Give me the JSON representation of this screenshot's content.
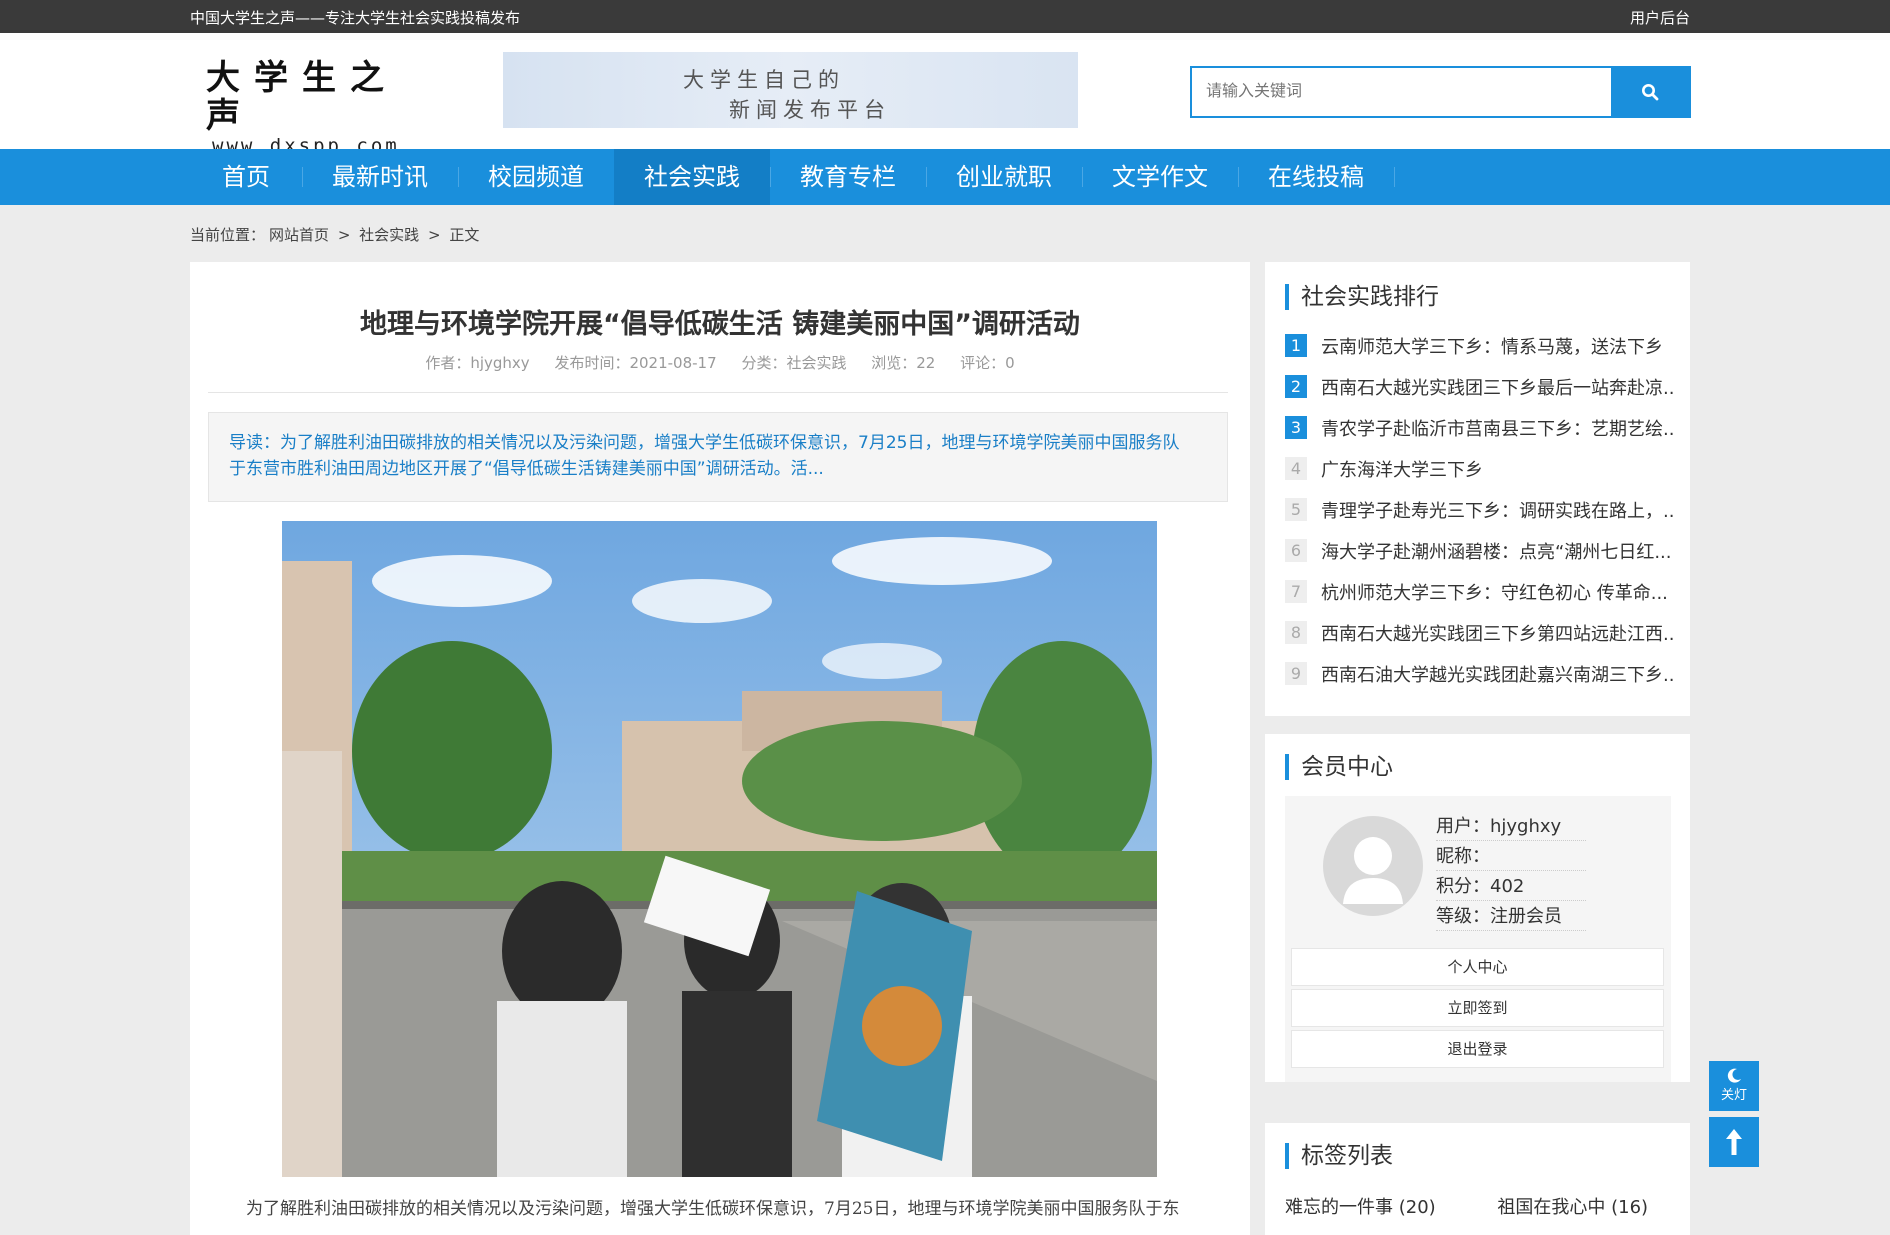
{
  "topbar": {
    "slogan": "中国大学生之声——专注大学生社会实践投稿发布",
    "admin": "用户后台"
  },
  "logo": {
    "name": "大学生之声",
    "domain": "www.dxspp.com"
  },
  "banner": {
    "line1": "大学生自己的",
    "line2": "新闻发布平台"
  },
  "search": {
    "placeholder": "请输入关键词"
  },
  "nav": [
    "首页",
    "最新时讯",
    "校园频道",
    "社会实践",
    "教育专栏",
    "创业就职",
    "文学作文",
    "在线投稿"
  ],
  "breadcrumb": {
    "prefix": "当前位置：",
    "home": "网站首页",
    "sep": ">",
    "category": "社会实践",
    "current": "正文"
  },
  "article": {
    "title": "地理与环境学院开展“倡导低碳生活 铸建美丽中国”调研活动",
    "author": "作者：hjyghxy",
    "date": "发布时间：2021-08-17",
    "category": "分类：社会实践",
    "views": "浏览：22",
    "comments": "评论：0",
    "lead_line1": "导读：为了解胜利油田碳排放的相关情况以及污染问题，增强大学生低碳环保意识，7月25日，地理与环境学院美丽中国服务队",
    "lead_line2": "于东营市胜利油田周边地区开展了“倡导低碳生活铸建美丽中国”调研活动。活...",
    "body": "为了解胜利油田碳排放的相关情况以及污染问题，增强大学生低碳环保意识，7月25日，地理与环境学院美丽中国服务队于东"
  },
  "ranking": {
    "title": "社会实践排行",
    "items": [
      {
        "n": "1",
        "t": "云南师范大学三下乡：情系马蔑，送法下乡"
      },
      {
        "n": "2",
        "t": "西南石大越光实践团三下乡最后一站奔赴凉..."
      },
      {
        "n": "3",
        "t": "青农学子赴临沂市莒南县三下乡：艺期艺绘..."
      },
      {
        "n": "4",
        "t": "广东海洋大学三下乡"
      },
      {
        "n": "5",
        "t": "青理学子赴寿光三下乡：调研实践在路上，..."
      },
      {
        "n": "6",
        "t": "海大学子赴潮州涵碧楼：点亮“潮州七日红..."
      },
      {
        "n": "7",
        "t": "杭州师范大学三下乡：守红色初心 传革命..."
      },
      {
        "n": "8",
        "t": "西南石大越光实践团三下乡第四站远赴江西..."
      },
      {
        "n": "9",
        "t": "西南石油大学越光实践团赴嘉兴南湖三下乡..."
      }
    ]
  },
  "member": {
    "title": "会员中心",
    "user": "用户：hjyghxy",
    "nickname": "昵称：",
    "points": "积分：402",
    "level": "等级：注册会员",
    "btn_center": "个人中心",
    "btn_sign": "立即签到",
    "btn_logout": "退出登录"
  },
  "tags": {
    "title": "标签列表",
    "items": [
      "难忘的一件事 (20)",
      "祖国在我心中 (16)"
    ]
  },
  "floats": {
    "light_label": "关灯"
  },
  "colors": {
    "brand_blue": "#1a8fdc",
    "topbar": "#3a3a3a",
    "page_bg": "#ececec"
  }
}
